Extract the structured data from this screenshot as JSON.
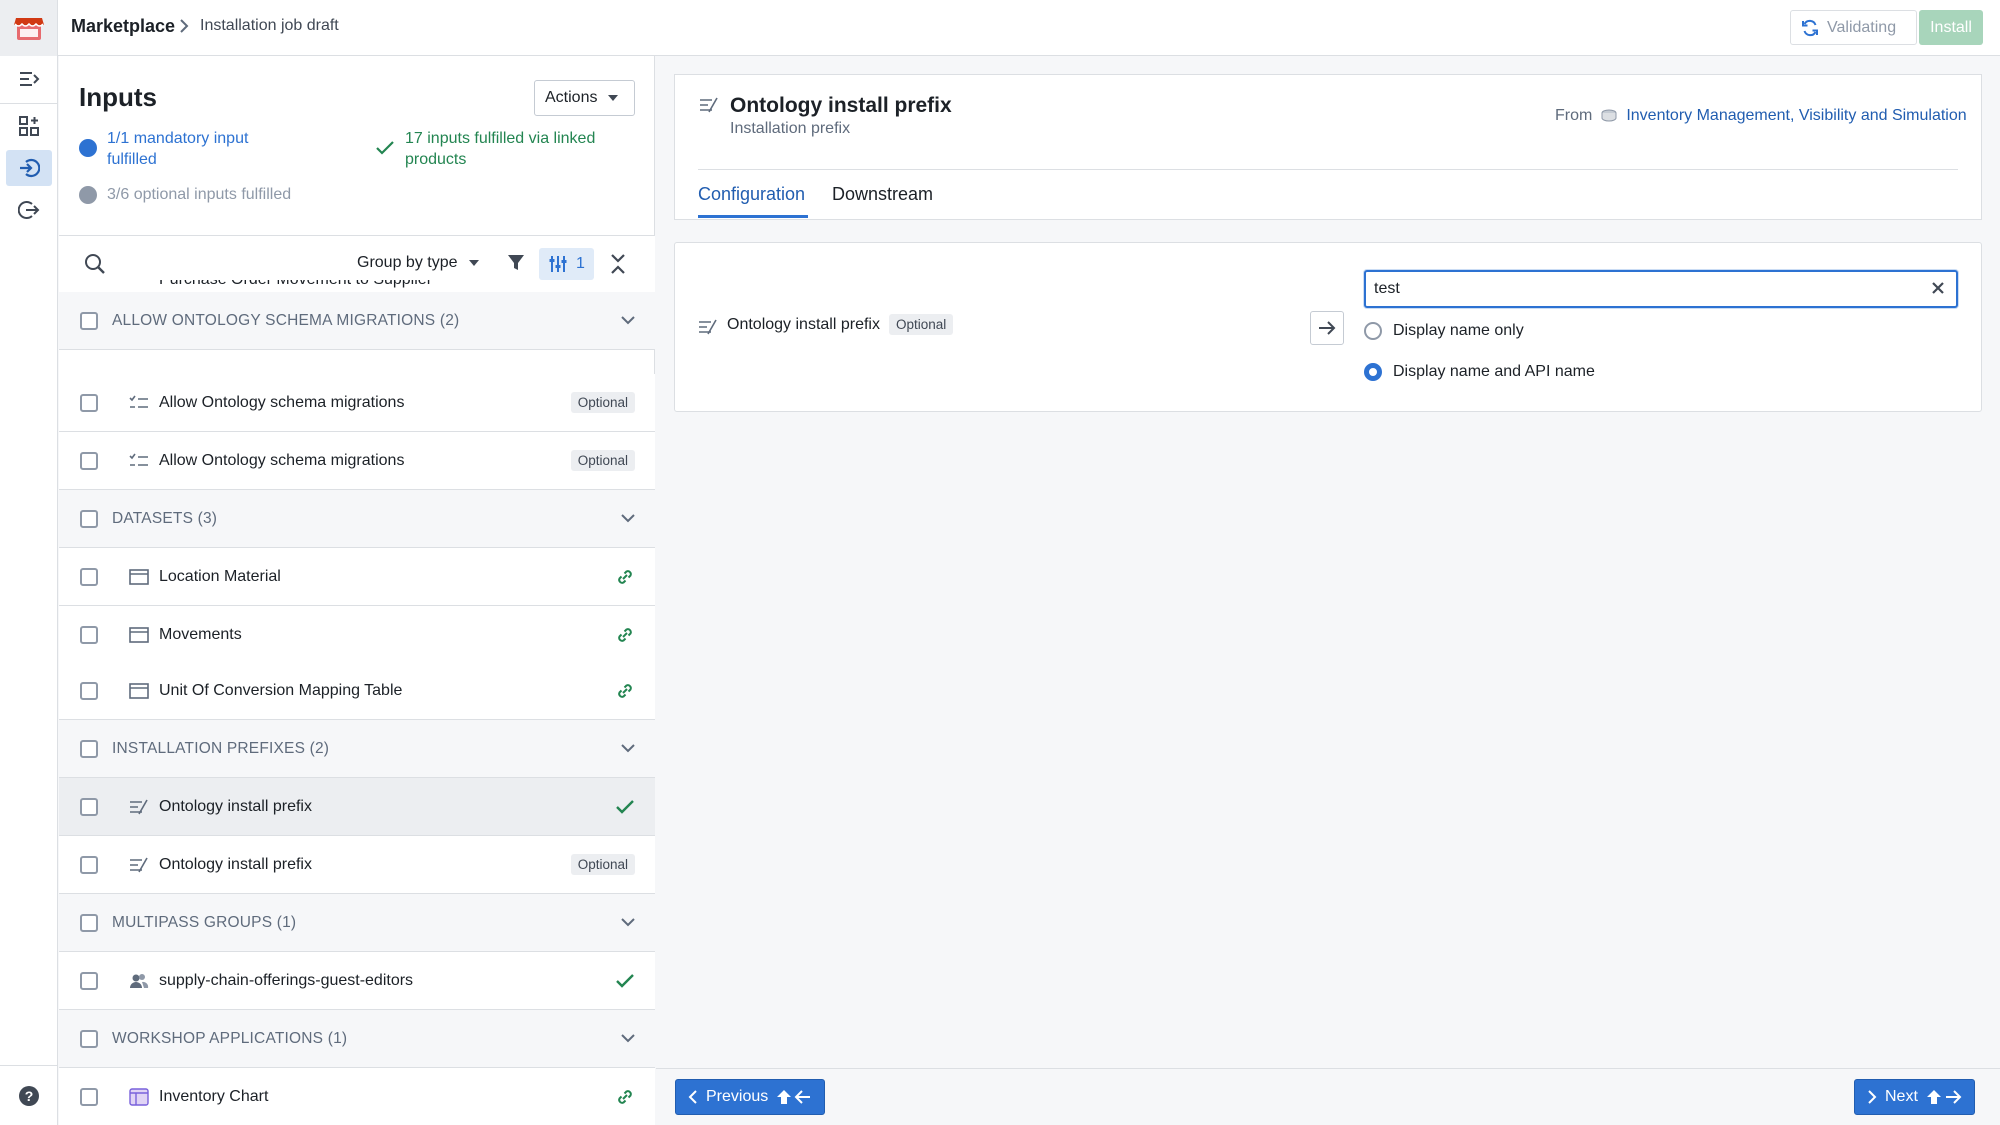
{
  "header": {
    "app": "Marketplace",
    "breadcrumb_current": "Installation job draft",
    "validating_label": "Validating",
    "install_label": "Install"
  },
  "inputs": {
    "title": "Inputs",
    "actions_label": "Actions",
    "mandatory_line1": "1/1 mandatory input",
    "mandatory_line2": "fulfilled",
    "linked_line1": "17 inputs fulfilled via linked",
    "linked_line2": "products",
    "optional_status": "3/6 optional inputs fulfilled",
    "group_by_label": "Group by type",
    "filter_count": "1",
    "cut_off_item": "Purchase Order Movement to Supplier",
    "groups": [
      {
        "label": "ALLOW ONTOLOGY SCHEMA MIGRATIONS (2)"
      },
      {
        "label": "DATASETS (3)"
      },
      {
        "label": "INSTALLATION PREFIXES (2)"
      },
      {
        "label": "MULTIPASS GROUPS (1)"
      },
      {
        "label": "WORKSHOP APPLICATIONS (1)"
      }
    ],
    "items": [
      {
        "label": "Allow Ontology schema migrations",
        "icon": "checklist-icon",
        "status": "Optional"
      },
      {
        "label": "Allow Ontology schema migrations",
        "icon": "checklist-icon",
        "status": "Optional"
      },
      {
        "label": "Location Material",
        "icon": "dataset-icon",
        "status": "linked"
      },
      {
        "label": "Movements",
        "icon": "dataset-icon",
        "status": "linked"
      },
      {
        "label": "Unit Of Conversion Mapping Table",
        "icon": "dataset-icon",
        "status": "linked"
      },
      {
        "label": "Ontology install prefix",
        "icon": "prefix-icon",
        "status": "fulfilled"
      },
      {
        "label": "Ontology install prefix",
        "icon": "prefix-icon",
        "status": "Optional"
      },
      {
        "label": "supply-chain-offerings-guest-editors",
        "icon": "group-icon",
        "status": "fulfilled"
      },
      {
        "label": "Inventory Chart",
        "icon": "workshop-icon",
        "status": "linked"
      }
    ]
  },
  "detail": {
    "title": "Ontology install prefix",
    "subtitle": "Installation prefix",
    "from_label": "From",
    "from_product": "Inventory Management, Visibility and Simulation",
    "tabs": [
      "Configuration",
      "Downstream"
    ],
    "config": {
      "label": "Ontology install prefix",
      "tag": "Optional",
      "value": "test",
      "options": [
        "Display name only",
        "Display name and API name"
      ],
      "selected_option": "Display name and API name"
    }
  },
  "footer": {
    "previous_label": "Previous",
    "next_label": "Next"
  },
  "colors": {
    "accent": "#2d72d2",
    "success": "#238551",
    "install_disabled": "#a8d5bb"
  }
}
